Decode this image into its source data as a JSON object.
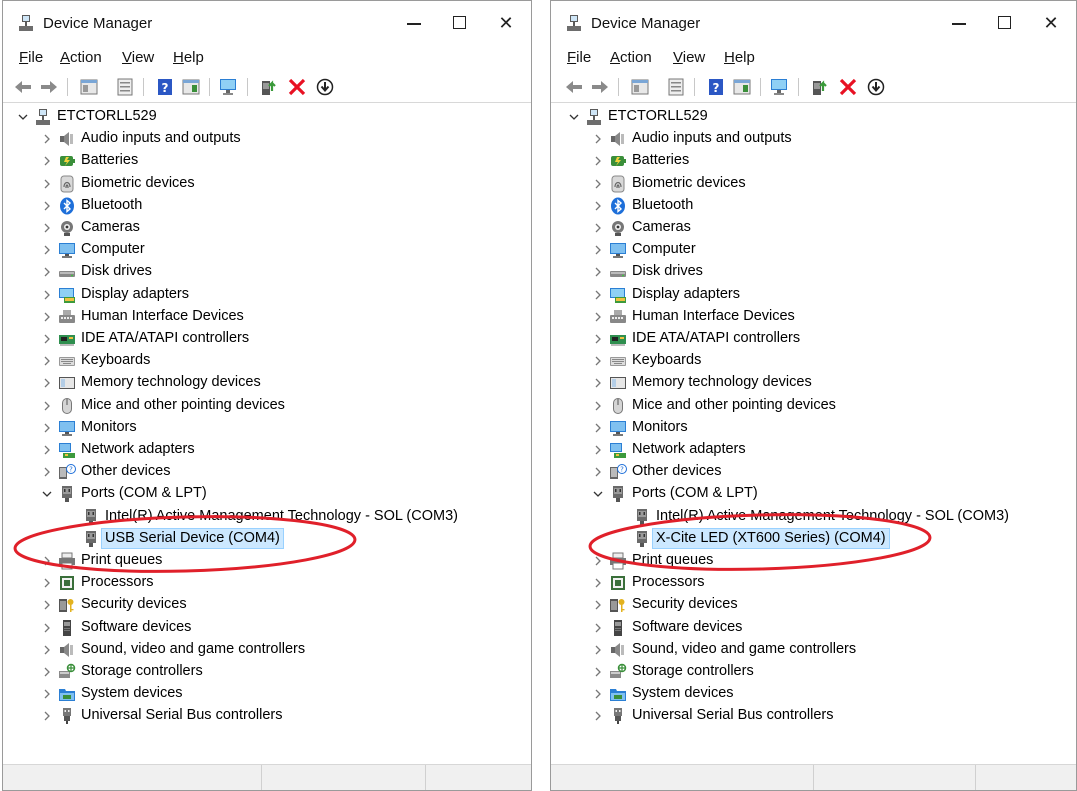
{
  "windows": [
    {
      "title": "Device Manager",
      "menu": [
        "File",
        "Action",
        "View",
        "Help"
      ],
      "computer": "ETCTORLL529",
      "categories": [
        {
          "label": "Audio inputs and outputs",
          "icon": "speaker-icon"
        },
        {
          "label": "Batteries",
          "icon": "battery-icon"
        },
        {
          "label": "Biometric devices",
          "icon": "fingerprint-icon"
        },
        {
          "label": "Bluetooth",
          "icon": "bluetooth-icon"
        },
        {
          "label": "Cameras",
          "icon": "camera-icon"
        },
        {
          "label": "Computer",
          "icon": "monitor-icon"
        },
        {
          "label": "Disk drives",
          "icon": "disk-drive-icon"
        },
        {
          "label": "Display adapters",
          "icon": "display-adapter-icon"
        },
        {
          "label": "Human Interface Devices",
          "icon": "hid-icon"
        },
        {
          "label": "IDE ATA/ATAPI controllers",
          "icon": "ide-controller-icon"
        },
        {
          "label": "Keyboards",
          "icon": "keyboard-icon"
        },
        {
          "label": "Memory technology devices",
          "icon": "memory-icon"
        },
        {
          "label": "Mice and other pointing devices",
          "icon": "mouse-icon"
        },
        {
          "label": "Monitors",
          "icon": "monitor-icon"
        },
        {
          "label": "Network adapters",
          "icon": "network-adapter-icon"
        },
        {
          "label": "Other devices",
          "icon": "unknown-device-icon"
        },
        {
          "label": "Ports (COM & LPT)",
          "icon": "port-icon",
          "expanded": true,
          "children": [
            {
              "label": "Intel(R) Active Management Technology - SOL (COM3)",
              "icon": "port-icon"
            },
            {
              "label": "USB Serial Device (COM4)",
              "icon": "port-icon",
              "selected": true
            }
          ]
        },
        {
          "label": "Print queues",
          "icon": "printer-icon"
        },
        {
          "label": "Processors",
          "icon": "processor-icon"
        },
        {
          "label": "Security devices",
          "icon": "security-key-icon"
        },
        {
          "label": "Software devices",
          "icon": "software-device-icon"
        },
        {
          "label": "Sound, video and game controllers",
          "icon": "speaker-icon"
        },
        {
          "label": "Storage controllers",
          "icon": "storage-controller-icon"
        },
        {
          "label": "System devices",
          "icon": "system-folder-icon"
        },
        {
          "label": "Universal Serial Bus controllers",
          "icon": "usb-icon"
        }
      ]
    },
    {
      "title": "Device Manager",
      "menu": [
        "File",
        "Action",
        "View",
        "Help"
      ],
      "computer": "ETCTORLL529",
      "categories": [
        {
          "label": "Audio inputs and outputs",
          "icon": "speaker-icon"
        },
        {
          "label": "Batteries",
          "icon": "battery-icon"
        },
        {
          "label": "Biometric devices",
          "icon": "fingerprint-icon"
        },
        {
          "label": "Bluetooth",
          "icon": "bluetooth-icon"
        },
        {
          "label": "Cameras",
          "icon": "camera-icon"
        },
        {
          "label": "Computer",
          "icon": "monitor-icon"
        },
        {
          "label": "Disk drives",
          "icon": "disk-drive-icon"
        },
        {
          "label": "Display adapters",
          "icon": "display-adapter-icon"
        },
        {
          "label": "Human Interface Devices",
          "icon": "hid-icon"
        },
        {
          "label": "IDE ATA/ATAPI controllers",
          "icon": "ide-controller-icon"
        },
        {
          "label": "Keyboards",
          "icon": "keyboard-icon"
        },
        {
          "label": "Memory technology devices",
          "icon": "memory-icon"
        },
        {
          "label": "Mice and other pointing devices",
          "icon": "mouse-icon"
        },
        {
          "label": "Monitors",
          "icon": "monitor-icon"
        },
        {
          "label": "Network adapters",
          "icon": "network-adapter-icon"
        },
        {
          "label": "Other devices",
          "icon": "unknown-device-icon"
        },
        {
          "label": "Ports (COM & LPT)",
          "icon": "port-icon",
          "expanded": true,
          "children": [
            {
              "label": "Intel(R) Active Management Technology - SOL (COM3)",
              "icon": "port-icon"
            },
            {
              "label": "X-Cite LED (XT600 Series) (COM4)",
              "icon": "port-icon",
              "selected": true
            }
          ]
        },
        {
          "label": "Print queues",
          "icon": "printer-icon"
        },
        {
          "label": "Processors",
          "icon": "processor-icon"
        },
        {
          "label": "Security devices",
          "icon": "security-key-icon"
        },
        {
          "label": "Software devices",
          "icon": "software-device-icon"
        },
        {
          "label": "Sound, video and game controllers",
          "icon": "speaker-icon"
        },
        {
          "label": "Storage controllers",
          "icon": "storage-controller-icon"
        },
        {
          "label": "System devices",
          "icon": "system-folder-icon"
        },
        {
          "label": "Universal Serial Bus controllers",
          "icon": "usb-icon"
        }
      ]
    }
  ],
  "toolbar_icons": [
    "back-arrow-icon",
    "forward-arrow-icon",
    "show-hide-tree-icon",
    "properties-icon",
    "help-icon",
    "action-view-icon",
    "scan-hardware-icon",
    "update-driver-icon",
    "uninstall-device-icon",
    "disable-device-icon"
  ],
  "colors": {
    "highlight_oval": "#e0202a",
    "selection_bg": "#cce8ff",
    "uninstall_red": "#e81123"
  }
}
